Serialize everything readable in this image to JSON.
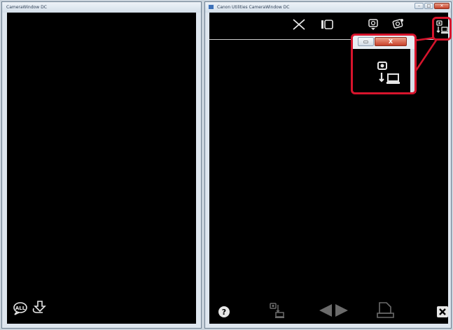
{
  "left_window": {
    "title": "CameraWindow DC",
    "footer_icons": [
      "all-images-icon",
      "import-icon"
    ]
  },
  "right_window": {
    "title": "Canon Utilities CameraWindow DC",
    "toolbar_icons": [
      "close-panel-icon",
      "panel-toggle-icon",
      "camera-info-icon",
      "camera-settings-icon",
      "camera-to-computer-icon"
    ],
    "footer_icons": [
      "help-icon",
      "transfer-icon",
      "previous-icon",
      "next-icon",
      "print-icon",
      "close-icon"
    ],
    "window_controls": [
      "minimize",
      "maximize",
      "close"
    ]
  },
  "zoom_popup": {
    "minimize_symbol": "▭",
    "close_symbol": "X",
    "icon": "camera-to-computer-icon"
  },
  "highlight_color": "#d7142c"
}
